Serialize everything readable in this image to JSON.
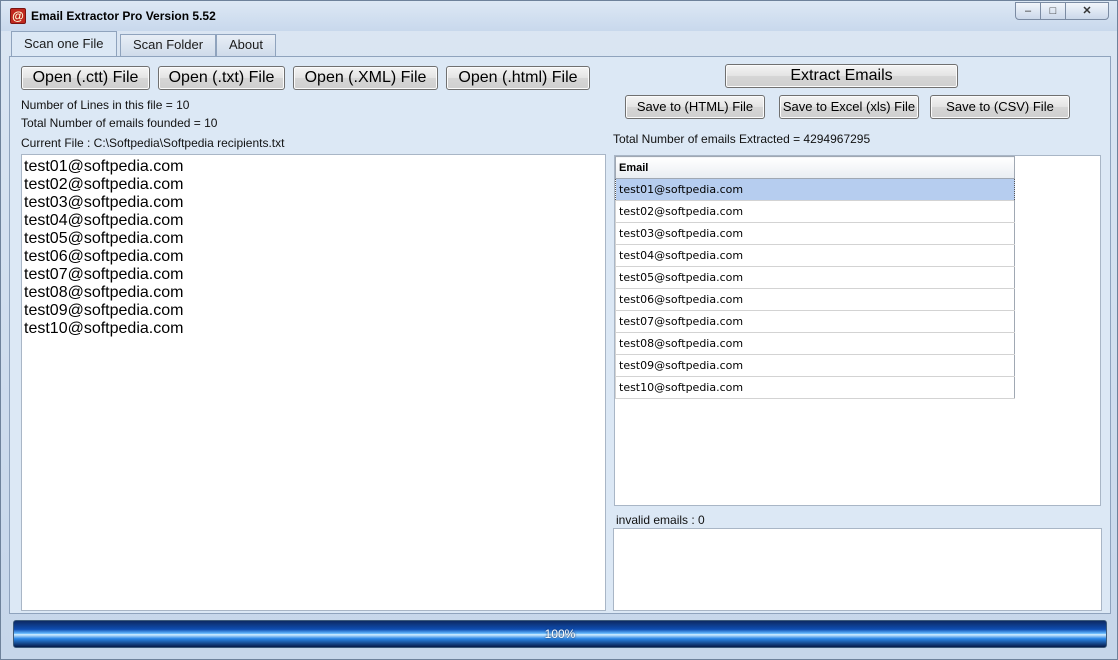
{
  "window": {
    "title": "Email Extractor Pro   Version 5.52",
    "app_icon_glyph": "@",
    "controls": {
      "minimize": "–",
      "maximize": "□",
      "close": "✕"
    }
  },
  "tabs": [
    {
      "label": "Scan one File",
      "active": true
    },
    {
      "label": "Scan Folder",
      "active": false
    },
    {
      "label": "About",
      "active": false
    }
  ],
  "open_buttons": {
    "ctt": "Open (.ctt) File",
    "txt": "Open (.txt) File",
    "xml": "Open (.XML) File",
    "html": "Open (.html) File"
  },
  "info": {
    "lines": "Number of Lines in this file = 10",
    "found": "Total Number of emails founded = 10",
    "current_file": "Current File : C:\\Softpedia\\Softpedia recipients.txt"
  },
  "source_lines": [
    "test01@softpedia.com",
    "test02@softpedia.com",
    "test03@softpedia.com",
    "test04@softpedia.com",
    "test05@softpedia.com",
    "test06@softpedia.com",
    "test07@softpedia.com",
    "test08@softpedia.com",
    "test09@softpedia.com",
    "test10@softpedia.com"
  ],
  "actions": {
    "extract": "Extract Emails",
    "save_html": "Save to (HTML) File",
    "save_xls": "Save to Excel (xls) File",
    "save_csv": "Save to (CSV) File"
  },
  "results": {
    "total_extracted": "Total Number of emails Extracted = 4294967295",
    "column_header": "Email",
    "selected_index": 0,
    "rows": [
      "test01@softpedia.com",
      "test02@softpedia.com",
      "test03@softpedia.com",
      "test04@softpedia.com",
      "test05@softpedia.com",
      "test06@softpedia.com",
      "test07@softpedia.com",
      "test08@softpedia.com",
      "test09@softpedia.com",
      "test10@softpedia.com"
    ],
    "invalid_label": "invalid emails : 0"
  },
  "progress": {
    "percent_value": 100,
    "label": "100%"
  }
}
